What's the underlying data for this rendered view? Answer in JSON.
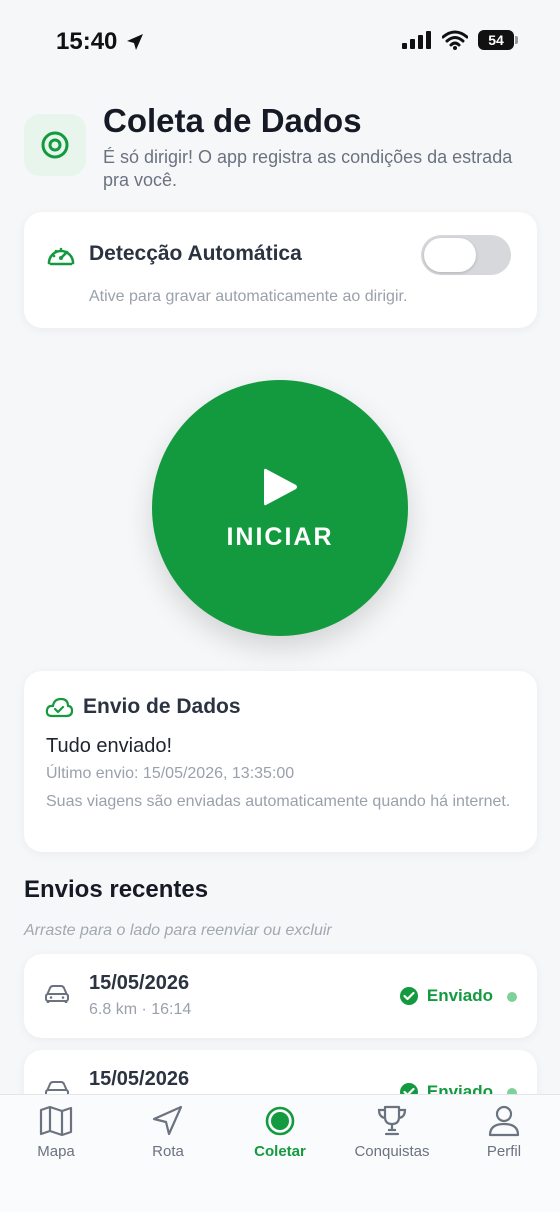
{
  "status_bar": {
    "time": "15:40",
    "battery": "54"
  },
  "header": {
    "title": "Coleta de Dados",
    "subtitle": "É só dirigir! O app registra as condições da estrada pra você."
  },
  "auto_detect": {
    "title": "Detecção Automática",
    "description": "Ative para gravar automaticamente ao dirigir.",
    "enabled": false
  },
  "start_button": {
    "label": "INICIAR"
  },
  "upload": {
    "title": "Envio de Dados",
    "status": "Tudo enviado!",
    "last_sent": "Último envio: 15/05/2026, 13:35:00",
    "note": "Suas viagens são enviadas automaticamente quando há internet."
  },
  "recent": {
    "title": "Envios recentes",
    "hint": "Arraste para o lado para reenviar ou excluir",
    "items": [
      {
        "date": "15/05/2026",
        "meta": "6.8 km · 16:14",
        "status": "Enviado"
      },
      {
        "date": "15/05/2026",
        "meta": "",
        "status": "Enviado"
      }
    ]
  },
  "tabs": [
    {
      "label": "Mapa",
      "icon": "map-icon",
      "active": false
    },
    {
      "label": "Rota",
      "icon": "navigation-icon",
      "active": false
    },
    {
      "label": "Coletar",
      "icon": "record-icon",
      "active": true
    },
    {
      "label": "Conquistas",
      "icon": "trophy-icon",
      "active": false
    },
    {
      "label": "Perfil",
      "icon": "user-icon",
      "active": false
    }
  ],
  "colors": {
    "accent": "#139a3f",
    "accent_light": "#e8f5ec",
    "background": "#f6f7f9"
  }
}
